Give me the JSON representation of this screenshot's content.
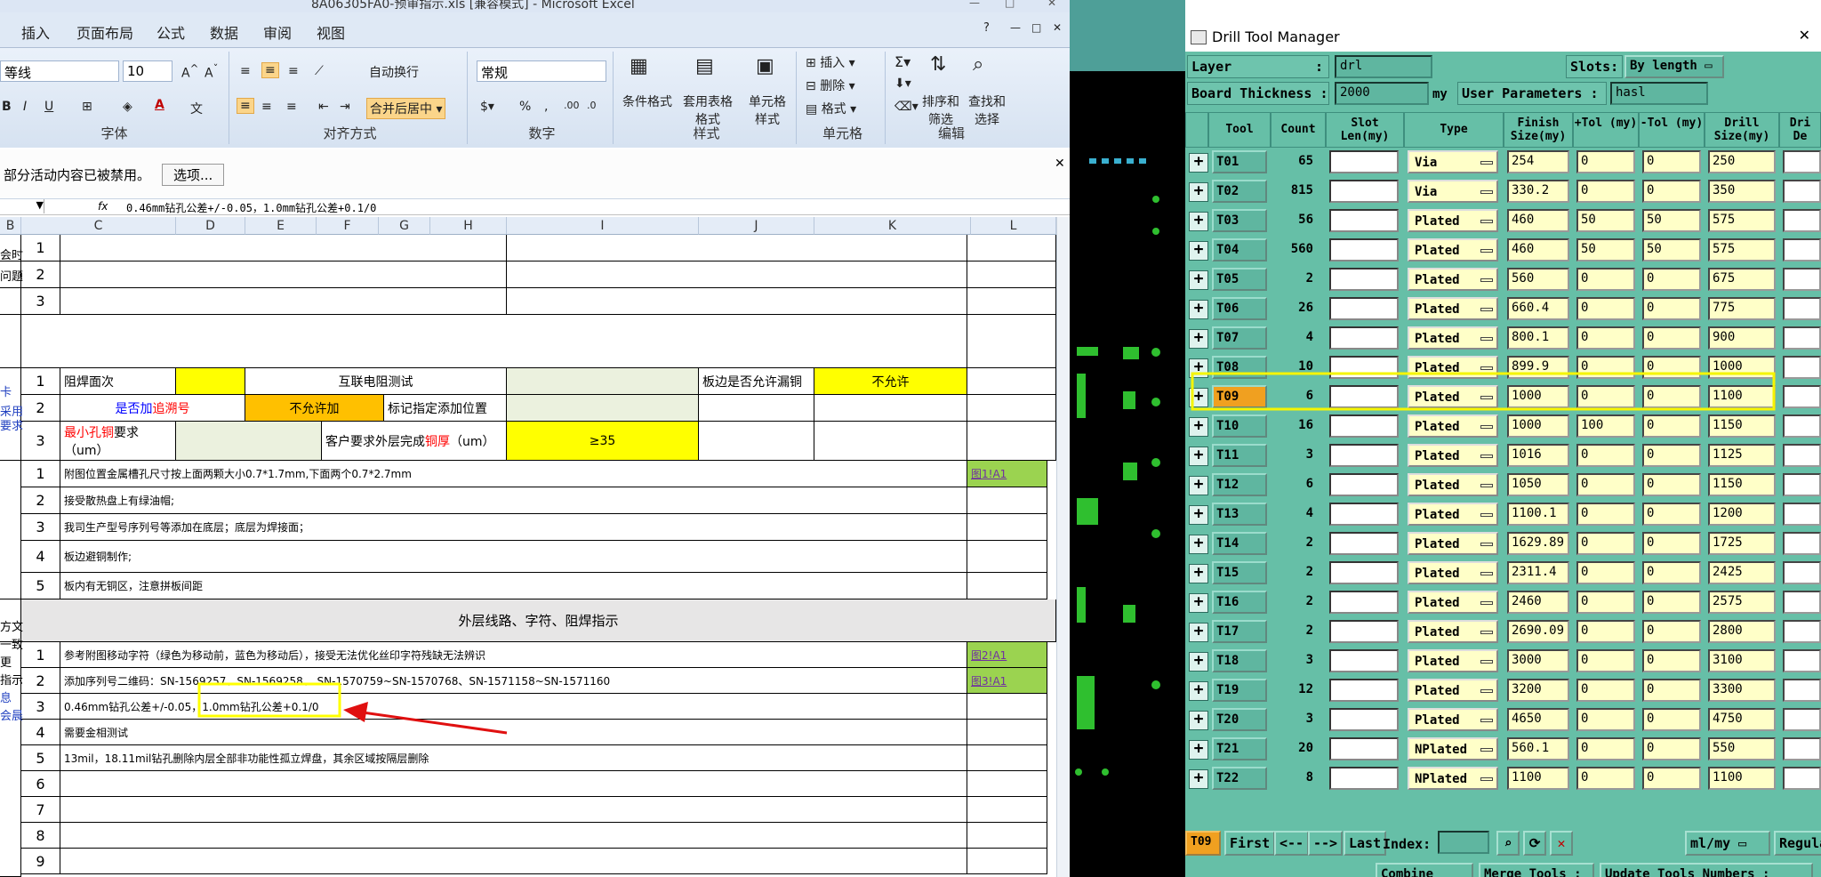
{
  "excel": {
    "title": "8A06305FA0-预审指示.xls  [兼容模式] - Microsoft Excel",
    "menu": [
      "插入",
      "页面布局",
      "公式",
      "数据",
      "审阅",
      "视图"
    ],
    "ribbon": {
      "font_name": "等线",
      "font_size": "10",
      "wrap_text": "自动换行",
      "merge_center": "合并后居中",
      "number_format": "常规",
      "cond_format": "条件格式",
      "table_format": "套用表格格式",
      "cell_style": "单元格样式",
      "insert": "插入",
      "delete": "删除",
      "format": "格式",
      "sort_filter": "排序和筛选",
      "find_select": "查找和选择",
      "groups": [
        "字体",
        "对齐方式",
        "数字",
        "样式",
        "单元格",
        "编辑"
      ]
    },
    "message": "部分活动内容已被禁用。",
    "options_button": "选项...",
    "formula_fx": "fx",
    "formula": "0.46mm钻孔公差+/-0.05，1.0mm钻孔公差+0.1/0",
    "columns": [
      "B",
      "C",
      "D",
      "E",
      "F",
      "G",
      "H",
      "I",
      "J",
      "K",
      "L"
    ],
    "side_texts": [
      "会时",
      "问题",
      "卡",
      "采用",
      "要求",
      "",
      "方文",
      "一致",
      "更",
      "指示",
      "息",
      "会晨"
    ],
    "rows_top": [
      "1",
      "2",
      "3"
    ],
    "req": {
      "r1_n": "1",
      "solder_face": "阻焊面次",
      "ic_test": "互联电阻测试",
      "edge_leak": "板边是否允许漏铜",
      "not_allowed": "不允许",
      "r2_n": "2",
      "trace_pre": "是否加",
      "trace_hl": "追溯号",
      "not_allowed_add": "不允许加",
      "mark_pos": "标记指定添加位置",
      "r3_n": "3",
      "min_hole_hl": "最小孔铜",
      "min_hole_suffix": "要求",
      "min_hole_unit": "（um）",
      "cust_pre": "客户要求外层完成",
      "cust_hl": "铜厚",
      "cust_unit": "（um）",
      "ge35": "≥35"
    },
    "notes1": [
      {
        "n": "1",
        "text": "附图位置金属槽孔尺寸按上面两颗大小0.7*1.7mm,下面两个0.7*2.7mm",
        "link": "图1!A1"
      },
      {
        "n": "2",
        "text": "接受散热盘上有绿油帽;",
        "link": ""
      },
      {
        "n": "3",
        "text": "我司生产型号序列号等添加在底层；底层为焊接面；",
        "link": ""
      },
      {
        "n": "4",
        "text": "板边避铜制作;",
        "link": ""
      },
      {
        "n": "5",
        "text": "板内有无铜区，注意拼板间距",
        "link": ""
      }
    ],
    "section_title": "外层线路、字符、阻焊指示",
    "notes2": [
      {
        "n": "1",
        "text": "参考附图移动字符（绿色为移动前，蓝色为移动后），接受无法优化丝印字符残缺无法辨识",
        "link": "图2!A1"
      },
      {
        "n": "2",
        "text": "添加序列号二维码：SN-1569257、SN-1569258、 SN-1570759~SN-1570768、SN-1571158~SN-1571160",
        "link": "图3!A1"
      },
      {
        "n": "3",
        "text_a": "0.46mm钻孔公差+/-0.05，",
        "text_b": "1.0mm钻孔公差+0.1/0",
        "link": ""
      },
      {
        "n": "4",
        "text": "需要金相测试",
        "link": ""
      },
      {
        "n": "5",
        "text": "13mil，18.11mil钻孔删除内层全部非功能性孤立焊盘，其余区域按隔层删除",
        "link": ""
      },
      {
        "n": "6",
        "text": "",
        "link": ""
      },
      {
        "n": "7",
        "text": "",
        "link": ""
      },
      {
        "n": "8",
        "text": "",
        "link": ""
      },
      {
        "n": "9",
        "text": "",
        "link": ""
      }
    ]
  },
  "drill": {
    "title": "Drill Tool Manager",
    "layer_label": "Layer",
    "layer_value": "drl",
    "slots_label": "Slots:",
    "slots_value": "By length",
    "thickness_label": "Board Thickness :",
    "thickness_value": "2000",
    "thickness_unit": "my",
    "user_params_label": "User Parameters :",
    "user_params_value": "hasl",
    "headers": [
      "Tool",
      "Count",
      "Slot Len(my)",
      "Type",
      "Finish Size(my)",
      "+Tol (my)",
      "-Tol (my)",
      "Drill Size(my)",
      "Dri De"
    ],
    "rows": [
      {
        "tool": "T01",
        "count": "65",
        "type": "Via",
        "finish": "254",
        "ptol": "0",
        "mtol": "0",
        "drill": "250"
      },
      {
        "tool": "T02",
        "count": "815",
        "type": "Via",
        "finish": "330.2",
        "ptol": "0",
        "mtol": "0",
        "drill": "350"
      },
      {
        "tool": "T03",
        "count": "56",
        "type": "Plated",
        "finish": "460",
        "ptol": "50",
        "mtol": "50",
        "drill": "575"
      },
      {
        "tool": "T04",
        "count": "560",
        "type": "Plated",
        "finish": "460",
        "ptol": "50",
        "mtol": "50",
        "drill": "575"
      },
      {
        "tool": "T05",
        "count": "2",
        "type": "Plated",
        "finish": "560",
        "ptol": "0",
        "mtol": "0",
        "drill": "675"
      },
      {
        "tool": "T06",
        "count": "26",
        "type": "Plated",
        "finish": "660.4",
        "ptol": "0",
        "mtol": "0",
        "drill": "775"
      },
      {
        "tool": "T07",
        "count": "4",
        "type": "Plated",
        "finish": "800.1",
        "ptol": "0",
        "mtol": "0",
        "drill": "900"
      },
      {
        "tool": "T08",
        "count": "10",
        "type": "Plated",
        "finish": "899.9",
        "ptol": "0",
        "mtol": "0",
        "drill": "1000"
      },
      {
        "tool": "T09",
        "count": "6",
        "type": "Plated",
        "finish": "1000",
        "ptol": "0",
        "mtol": "0",
        "drill": "1100"
      },
      {
        "tool": "T10",
        "count": "16",
        "type": "Plated",
        "finish": "1000",
        "ptol": "100",
        "mtol": "0",
        "drill": "1150"
      },
      {
        "tool": "T11",
        "count": "3",
        "type": "Plated",
        "finish": "1016",
        "ptol": "0",
        "mtol": "0",
        "drill": "1125"
      },
      {
        "tool": "T12",
        "count": "6",
        "type": "Plated",
        "finish": "1050",
        "ptol": "0",
        "mtol": "0",
        "drill": "1150"
      },
      {
        "tool": "T13",
        "count": "4",
        "type": "Plated",
        "finish": "1100.1",
        "ptol": "0",
        "mtol": "0",
        "drill": "1200"
      },
      {
        "tool": "T14",
        "count": "2",
        "type": "Plated",
        "finish": "1629.89",
        "ptol": "0",
        "mtol": "0",
        "drill": "1725"
      },
      {
        "tool": "T15",
        "count": "2",
        "type": "Plated",
        "finish": "2311.4",
        "ptol": "0",
        "mtol": "0",
        "drill": "2425"
      },
      {
        "tool": "T16",
        "count": "2",
        "type": "Plated",
        "finish": "2460",
        "ptol": "0",
        "mtol": "0",
        "drill": "2575"
      },
      {
        "tool": "T17",
        "count": "2",
        "type": "Plated",
        "finish": "2690.09",
        "ptol": "0",
        "mtol": "0",
        "drill": "2800"
      },
      {
        "tool": "T18",
        "count": "3",
        "type": "Plated",
        "finish": "3000",
        "ptol": "0",
        "mtol": "0",
        "drill": "3100"
      },
      {
        "tool": "T19",
        "count": "12",
        "type": "Plated",
        "finish": "3200",
        "ptol": "0",
        "mtol": "0",
        "drill": "3300"
      },
      {
        "tool": "T20",
        "count": "3",
        "type": "Plated",
        "finish": "4650",
        "ptol": "0",
        "mtol": "0",
        "drill": "4750"
      },
      {
        "tool": "T21",
        "count": "20",
        "type": "NPlated",
        "finish": "560.1",
        "ptol": "0",
        "mtol": "0",
        "drill": "550"
      },
      {
        "tool": "T22",
        "count": "8",
        "type": "NPlated",
        "finish": "1100",
        "ptol": "0",
        "mtol": "0",
        "drill": "1100"
      }
    ],
    "selected_tool": "T09",
    "first": "First",
    "prev": "<--",
    "next": "-->",
    "last": "Last",
    "index_label": "Index:",
    "units": "ml/my",
    "regular": "Regula",
    "combine": "Combine Tools",
    "merge": "Merge Tools :",
    "update": "Update Tools Numbers :"
  }
}
